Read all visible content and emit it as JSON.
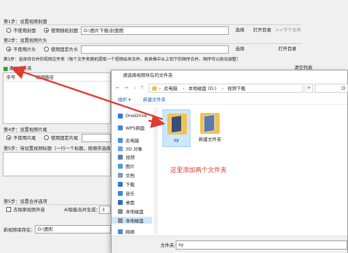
{
  "main": {
    "step1": {
      "title": "第1步：设置视频封面",
      "opt_none": "不使用封面",
      "opt_random": "使用随机封面",
      "path": "D:\\图片下载\\封面图",
      "select": "选择",
      "open": "打开目录",
      "next": ">>下个文件"
    },
    "step2": {
      "title": "第2步：设置视频片头",
      "opt_none": "不使用片头",
      "opt_fixed": "使用固定片头",
      "select": "选择",
      "open": "打开目录"
    },
    "step3": {
      "title": "第3步：选择待合并的视频文件夹（每个文件夹随机提取一个视频出来合并，按表格中从上到下的顺序合并，顺序可以拖动调整）",
      "add_folder": "添加文件夹",
      "col_index": "序号",
      "col_path": "视频路径",
      "clear_list": "清空列表"
    },
    "step4": {
      "title": "第4步：设置视频片尾",
      "opt_none": "不使用片尾",
      "opt_fixed": "使用固定片尾"
    },
    "step5": {
      "title": "第5步：待设置视频标题（一行一个标题，按顺序选择"
    },
    "step6": {
      "title": "第5步：设置合并选项",
      "remove_audio": "去除原视频声音",
      "ai_label": "AI智能合并生成：",
      "ai_value": "3"
    },
    "save": {
      "label": "新视频保存在：",
      "path": "D:\\图形"
    }
  },
  "dialog": {
    "title": "请选择视频所在的文件夹",
    "breadcrumb": [
      "此电脑",
      "本地磁盘 (D:)",
      "视频下载"
    ],
    "toolbar": {
      "organize": "组织 ▾",
      "new_folder": "新建文件夹"
    },
    "sidebar": [
      {
        "label": "OneDrive",
        "color": "#2f7bd8"
      },
      {
        "label": "WPS网盘",
        "color": "#3f84e0"
      },
      {
        "label": "此电脑",
        "color": "#4a90d9"
      },
      {
        "label": "3D 对象",
        "color": "#6aa7e6"
      },
      {
        "label": "视频",
        "color": "#5b7fb3"
      },
      {
        "label": "图片",
        "color": "#4e9fd4"
      },
      {
        "label": "文档",
        "color": "#7a9cc6"
      },
      {
        "label": "下载",
        "color": "#2d7ad0"
      },
      {
        "label": "音乐",
        "color": "#3c86d6"
      },
      {
        "label": "桌面",
        "color": "#2e6fb6"
      },
      {
        "label": "本地磁盘",
        "color": "#8a8f96"
      },
      {
        "label": "本地磁盘",
        "color": "#8a8f96"
      },
      {
        "label": "网络",
        "color": "#4d8ad4"
      }
    ],
    "folders": [
      {
        "name": "sy",
        "selected": true
      },
      {
        "name": "新建文件夹",
        "selected": false
      }
    ],
    "annotation": "这里添加两个文件夹",
    "filename_label": "文件夹:",
    "filename_value": "sy"
  },
  "colors": {
    "annotation": "#e03c31",
    "arrow": "#e03c31",
    "selection": "#cce8ff",
    "folder": "#f2c14e",
    "link": "#1a5fb4"
  }
}
